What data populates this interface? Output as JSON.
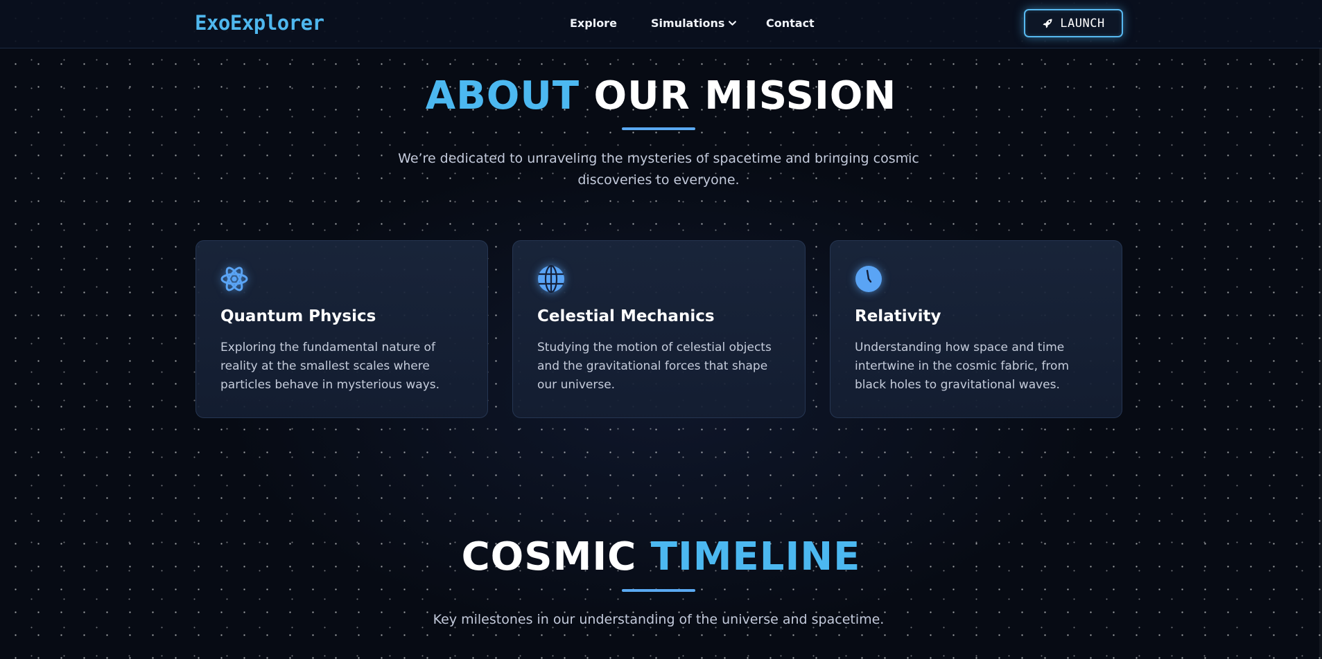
{
  "nav": {
    "logo": "ExoExplorer",
    "links": [
      {
        "label": "Explore"
      },
      {
        "label": "Simulations"
      },
      {
        "label": "Contact"
      }
    ],
    "launch_label": "LAUNCH"
  },
  "about": {
    "title_accent": "ABOUT",
    "title_rest": "OUR MISSION",
    "lead": "We’re dedicated to unraveling the mysteries of spacetime and bringing cosmic discoveries to everyone."
  },
  "cards": [
    {
      "icon": "atom-icon",
      "title": "Quantum Physics",
      "text": "Exploring the fundamental nature of reality at the smallest scales where particles behave in mysterious ways."
    },
    {
      "icon": "globe-icon",
      "title": "Celestial Mechanics",
      "text": "Studying the motion of celestial objects and the gravitational forces that shape our universe."
    },
    {
      "icon": "clock-icon",
      "title": "Relativity",
      "text": "Understanding how space and time intertwine in the cosmic fabric, from black holes to gravitational waves."
    }
  ],
  "timeline": {
    "title_white": "COSMIC",
    "title_accent": "TIMELINE",
    "lead": "Key milestones in our understanding of the universe and spacetime."
  },
  "colors": {
    "accent": "#4cb8f0",
    "background": "#070b14",
    "card": "#1a263c"
  }
}
